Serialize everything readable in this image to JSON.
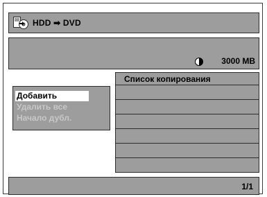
{
  "header": {
    "icon": "hdd-to-dvd-icon",
    "title": "HDD ➡ DVD"
  },
  "info": {
    "space_icon": "disc-space-pie-icon",
    "space_value": "3000 MB"
  },
  "copy_list": {
    "title": "Список копирования",
    "rows": [
      "",
      "",
      "",
      "",
      "",
      ""
    ]
  },
  "menu": {
    "items": [
      {
        "label": "Добавить",
        "state": "selected"
      },
      {
        "label": "Удалить все",
        "state": "disabled"
      },
      {
        "label": "Начало дубл.",
        "state": "disabled"
      }
    ]
  },
  "footer": {
    "page": "1/1"
  },
  "colors": {
    "panel": "#9d9d9d",
    "border": "#2d2d2d",
    "disabled_text": "#c8c8c8",
    "selected_bg": "#ffffff"
  }
}
